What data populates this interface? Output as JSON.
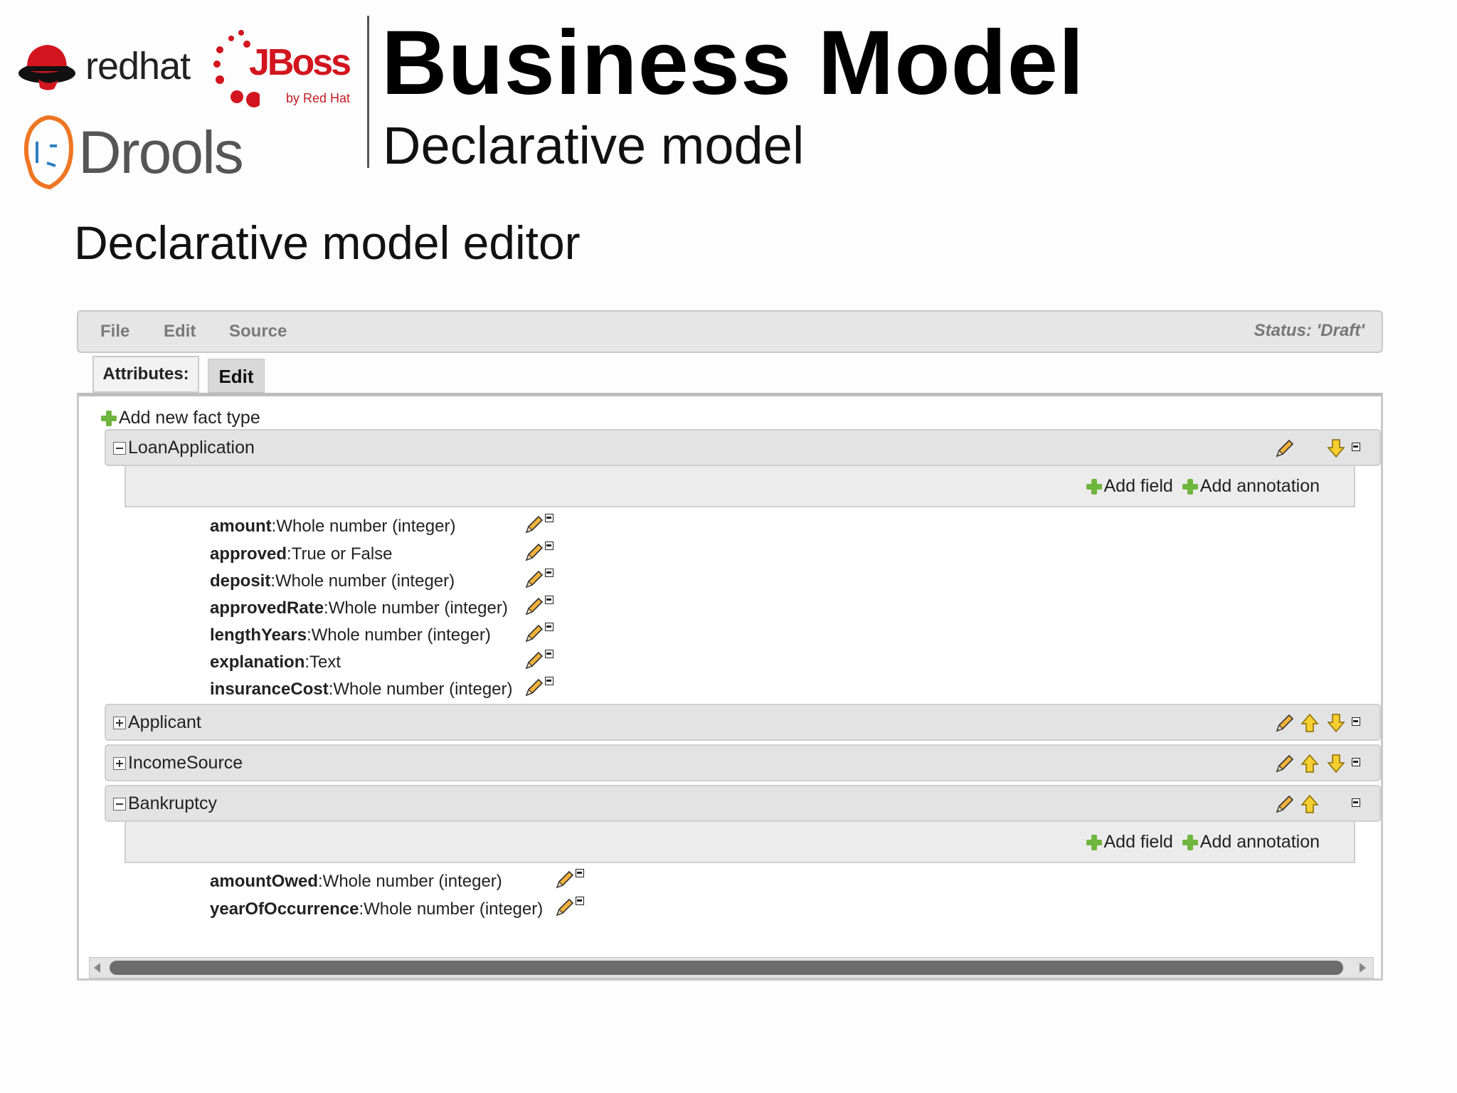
{
  "header": {
    "logos": {
      "redhat": "redhat",
      "jboss": "JBoss",
      "jboss_by": "by Red Hat",
      "drools": "Drools"
    },
    "title": "Business Model",
    "subtitle": "Declarative model"
  },
  "section_heading": "Declarative model editor",
  "menubar": {
    "items": [
      "File",
      "Edit",
      "Source"
    ],
    "status": "Status: 'Draft'"
  },
  "tabs": {
    "attributes": "Attributes:",
    "edit": "Edit"
  },
  "add_fact_label": "Add new fact type",
  "facts": [
    {
      "name": "LoanApplication",
      "expanded": true,
      "add_field": "Add field",
      "add_annotation": "Add annotation",
      "fields": [
        {
          "name": "amount",
          "type": ":Whole number (integer)"
        },
        {
          "name": "approved",
          "type": ":True or False"
        },
        {
          "name": "deposit",
          "type": ":Whole number (integer)"
        },
        {
          "name": "approvedRate",
          "type": ":Whole number (integer)"
        },
        {
          "name": "lengthYears",
          "type": ":Whole number (integer)"
        },
        {
          "name": "explanation",
          "type": ":Text"
        },
        {
          "name": "insuranceCost",
          "type": ":Whole number (integer)"
        }
      ]
    },
    {
      "name": "Applicant",
      "expanded": false
    },
    {
      "name": "IncomeSource",
      "expanded": false
    },
    {
      "name": "Bankruptcy",
      "expanded": true,
      "add_field": "Add field",
      "add_annotation": "Add annotation",
      "fields": [
        {
          "name": "amountOwed",
          "type": ":Whole number (integer)"
        },
        {
          "name": "yearOfOccurrence",
          "type": ":Whole number (integer)"
        }
      ]
    }
  ],
  "icons": {
    "edit": "pencil-icon",
    "move_up": "arrow-up-icon",
    "move_down": "arrow-down-icon",
    "delete": "delete-icon",
    "add": "plus-icon",
    "expand": "expand-icon",
    "collapse": "collapse-icon"
  },
  "colors": {
    "brand_red": "#d2151e",
    "add_green": "#6fb63f",
    "arrow_yellow": "#f2c200"
  }
}
